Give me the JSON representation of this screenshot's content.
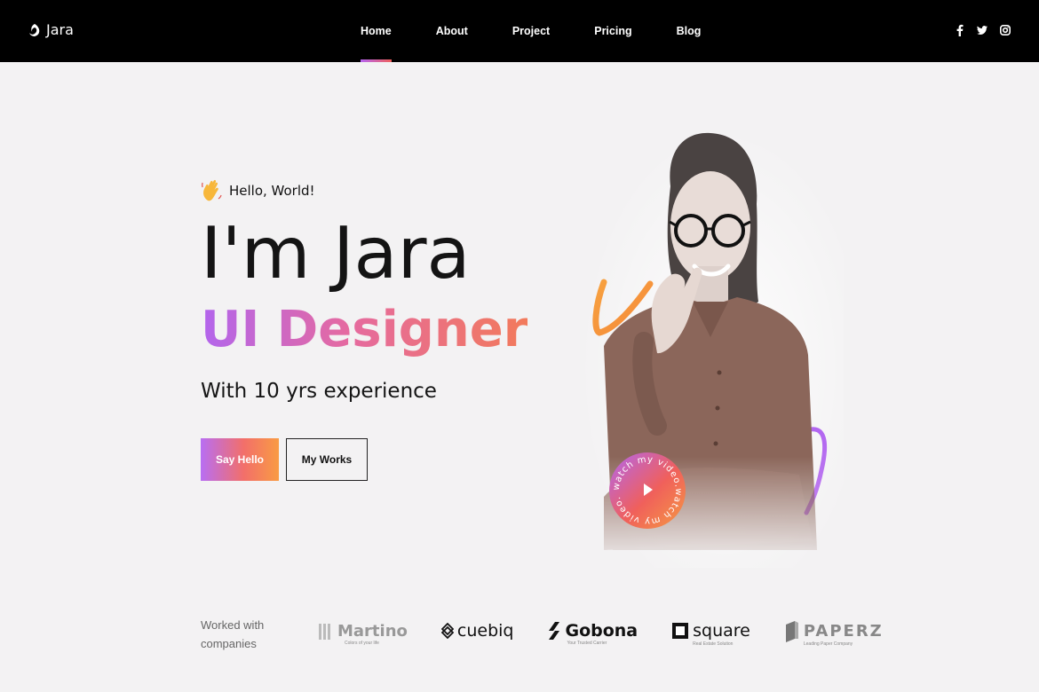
{
  "header": {
    "logo_text": "Jara",
    "nav": [
      {
        "label": "Home",
        "active": true
      },
      {
        "label": "About",
        "active": false
      },
      {
        "label": "Project",
        "active": false
      },
      {
        "label": "Pricing",
        "active": false
      },
      {
        "label": "Blog",
        "active": false
      }
    ],
    "social_icons": [
      "facebook-icon",
      "twitter-icon",
      "instagram-icon"
    ]
  },
  "hero": {
    "greeting": "Hello, World!",
    "name": "I'm Jara",
    "role": "UI Designer",
    "experience": "With 10 yrs experience",
    "primary_button": "Say Hello",
    "secondary_button": "My Works",
    "video_badge_text": "watch my video.watch my video."
  },
  "companies": {
    "label_line1": "Worked with",
    "label_line2": "companies",
    "logos": [
      {
        "name": "Martino",
        "tagline": "Colors of your life"
      },
      {
        "name": "cuebiq",
        "tagline": ""
      },
      {
        "name": "Gobona",
        "tagline": "Your Trusted Carrier"
      },
      {
        "name": "square",
        "tagline": "Real Estate Solution"
      },
      {
        "name": "PAPERZ",
        "tagline": "Leading Paper Company"
      }
    ]
  },
  "colors": {
    "accent_start": "#b265ed",
    "accent_mid": "#e56aa0",
    "accent_end": "#f27a5b",
    "header_bg": "#000000",
    "page_bg": "#f3f2f3"
  }
}
